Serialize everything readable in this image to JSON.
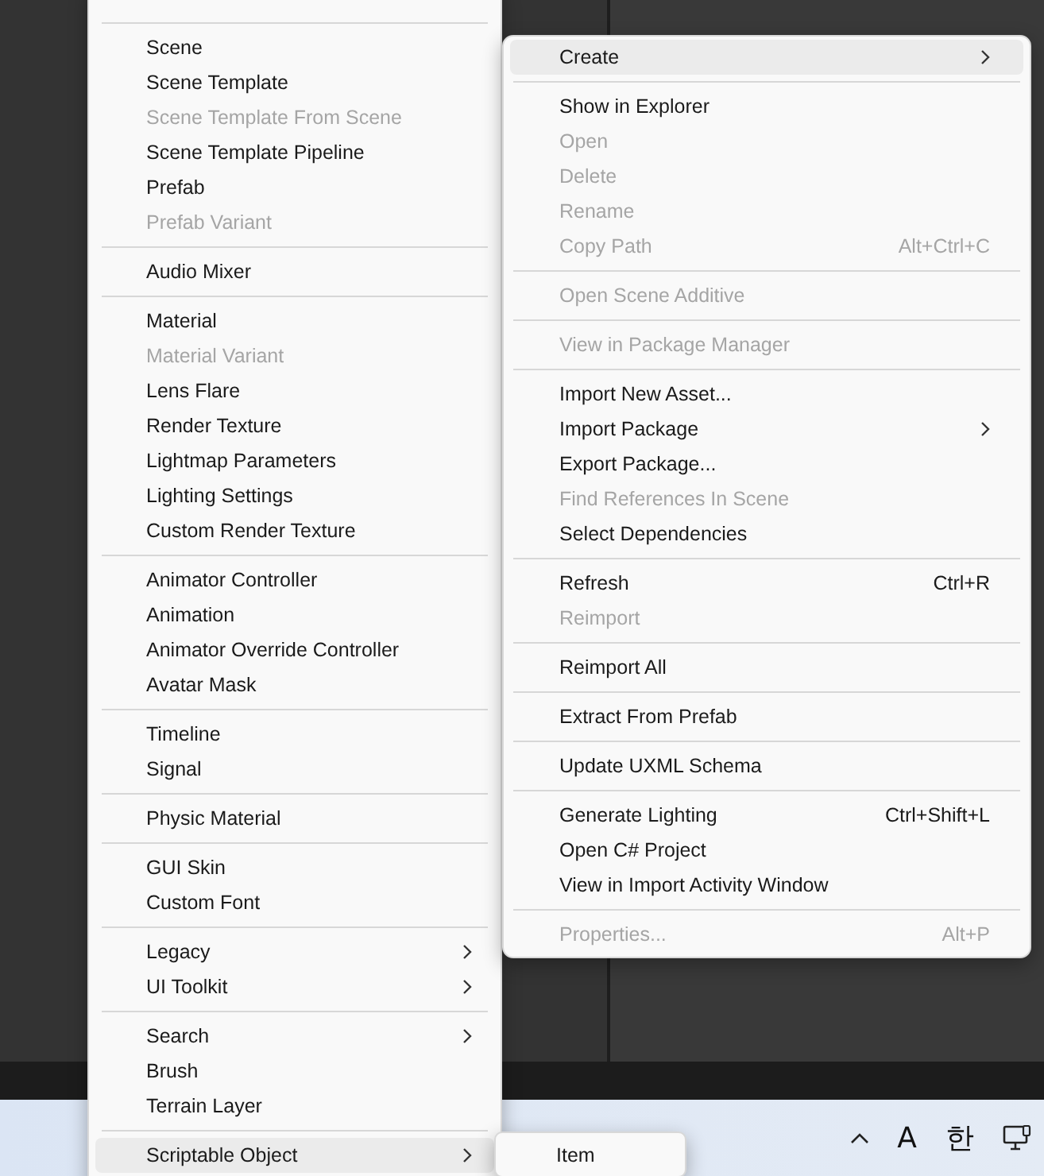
{
  "left_menu": {
    "items": [
      {
        "kind": "separator"
      },
      {
        "kind": "item",
        "label": "Scene",
        "disabled": false,
        "submenu": false,
        "selected": false
      },
      {
        "kind": "item",
        "label": "Scene Template",
        "disabled": false,
        "submenu": false,
        "selected": false
      },
      {
        "kind": "item",
        "label": "Scene Template From Scene",
        "disabled": true,
        "submenu": false,
        "selected": false
      },
      {
        "kind": "item",
        "label": "Scene Template Pipeline",
        "disabled": false,
        "submenu": false,
        "selected": false
      },
      {
        "kind": "item",
        "label": "Prefab",
        "disabled": false,
        "submenu": false,
        "selected": false
      },
      {
        "kind": "item",
        "label": "Prefab Variant",
        "disabled": true,
        "submenu": false,
        "selected": false
      },
      {
        "kind": "separator"
      },
      {
        "kind": "item",
        "label": "Audio Mixer",
        "disabled": false,
        "submenu": false,
        "selected": false
      },
      {
        "kind": "separator"
      },
      {
        "kind": "item",
        "label": "Material",
        "disabled": false,
        "submenu": false,
        "selected": false
      },
      {
        "kind": "item",
        "label": "Material Variant",
        "disabled": true,
        "submenu": false,
        "selected": false
      },
      {
        "kind": "item",
        "label": "Lens Flare",
        "disabled": false,
        "submenu": false,
        "selected": false
      },
      {
        "kind": "item",
        "label": "Render Texture",
        "disabled": false,
        "submenu": false,
        "selected": false
      },
      {
        "kind": "item",
        "label": "Lightmap Parameters",
        "disabled": false,
        "submenu": false,
        "selected": false
      },
      {
        "kind": "item",
        "label": "Lighting Settings",
        "disabled": false,
        "submenu": false,
        "selected": false
      },
      {
        "kind": "item",
        "label": "Custom Render Texture",
        "disabled": false,
        "submenu": false,
        "selected": false
      },
      {
        "kind": "separator"
      },
      {
        "kind": "item",
        "label": "Animator Controller",
        "disabled": false,
        "submenu": false,
        "selected": false
      },
      {
        "kind": "item",
        "label": "Animation",
        "disabled": false,
        "submenu": false,
        "selected": false
      },
      {
        "kind": "item",
        "label": "Animator Override Controller",
        "disabled": false,
        "submenu": false,
        "selected": false
      },
      {
        "kind": "item",
        "label": "Avatar Mask",
        "disabled": false,
        "submenu": false,
        "selected": false
      },
      {
        "kind": "separator"
      },
      {
        "kind": "item",
        "label": "Timeline",
        "disabled": false,
        "submenu": false,
        "selected": false
      },
      {
        "kind": "item",
        "label": "Signal",
        "disabled": false,
        "submenu": false,
        "selected": false
      },
      {
        "kind": "separator"
      },
      {
        "kind": "item",
        "label": "Physic Material",
        "disabled": false,
        "submenu": false,
        "selected": false
      },
      {
        "kind": "separator"
      },
      {
        "kind": "item",
        "label": "GUI Skin",
        "disabled": false,
        "submenu": false,
        "selected": false
      },
      {
        "kind": "item",
        "label": "Custom Font",
        "disabled": false,
        "submenu": false,
        "selected": false
      },
      {
        "kind": "separator"
      },
      {
        "kind": "item",
        "label": "Legacy",
        "disabled": false,
        "submenu": true,
        "selected": false
      },
      {
        "kind": "item",
        "label": "UI Toolkit",
        "disabled": false,
        "submenu": true,
        "selected": false
      },
      {
        "kind": "separator"
      },
      {
        "kind": "item",
        "label": "Search",
        "disabled": false,
        "submenu": true,
        "selected": false
      },
      {
        "kind": "item",
        "label": "Brush",
        "disabled": false,
        "submenu": false,
        "selected": false
      },
      {
        "kind": "item",
        "label": "Terrain Layer",
        "disabled": false,
        "submenu": false,
        "selected": false
      },
      {
        "kind": "separator"
      },
      {
        "kind": "item",
        "label": "Scriptable Object",
        "disabled": false,
        "submenu": true,
        "selected": true
      }
    ]
  },
  "context_menu": {
    "items": [
      {
        "kind": "item",
        "label": "Create",
        "disabled": false,
        "submenu": true,
        "selected": true
      },
      {
        "kind": "separator"
      },
      {
        "kind": "item",
        "label": "Show in Explorer",
        "disabled": false,
        "submenu": false,
        "selected": false
      },
      {
        "kind": "item",
        "label": "Open",
        "disabled": true,
        "submenu": false,
        "selected": false
      },
      {
        "kind": "item",
        "label": "Delete",
        "disabled": true,
        "submenu": false,
        "selected": false
      },
      {
        "kind": "item",
        "label": "Rename",
        "disabled": true,
        "submenu": false,
        "selected": false
      },
      {
        "kind": "item",
        "label": "Copy Path",
        "disabled": true,
        "submenu": false,
        "selected": false,
        "shortcut": "Alt+Ctrl+C"
      },
      {
        "kind": "separator"
      },
      {
        "kind": "item",
        "label": "Open Scene Additive",
        "disabled": true,
        "submenu": false,
        "selected": false
      },
      {
        "kind": "separator"
      },
      {
        "kind": "item",
        "label": "View in Package Manager",
        "disabled": true,
        "submenu": false,
        "selected": false
      },
      {
        "kind": "separator"
      },
      {
        "kind": "item",
        "label": "Import New Asset...",
        "disabled": false,
        "submenu": false,
        "selected": false
      },
      {
        "kind": "item",
        "label": "Import Package",
        "disabled": false,
        "submenu": true,
        "selected": false
      },
      {
        "kind": "item",
        "label": "Export Package...",
        "disabled": false,
        "submenu": false,
        "selected": false
      },
      {
        "kind": "item",
        "label": "Find References In Scene",
        "disabled": true,
        "submenu": false,
        "selected": false
      },
      {
        "kind": "item",
        "label": "Select Dependencies",
        "disabled": false,
        "submenu": false,
        "selected": false
      },
      {
        "kind": "separator"
      },
      {
        "kind": "item",
        "label": "Refresh",
        "disabled": false,
        "submenu": false,
        "selected": false,
        "shortcut": "Ctrl+R"
      },
      {
        "kind": "item",
        "label": "Reimport",
        "disabled": true,
        "submenu": false,
        "selected": false
      },
      {
        "kind": "separator"
      },
      {
        "kind": "item",
        "label": "Reimport All",
        "disabled": false,
        "submenu": false,
        "selected": false
      },
      {
        "kind": "separator"
      },
      {
        "kind": "item",
        "label": "Extract From Prefab",
        "disabled": false,
        "submenu": false,
        "selected": false
      },
      {
        "kind": "separator"
      },
      {
        "kind": "item",
        "label": "Update UXML Schema",
        "disabled": false,
        "submenu": false,
        "selected": false
      },
      {
        "kind": "separator"
      },
      {
        "kind": "item",
        "label": "Generate Lighting",
        "disabled": false,
        "submenu": false,
        "selected": false,
        "shortcut": "Ctrl+Shift+L"
      },
      {
        "kind": "item",
        "label": "Open C# Project",
        "disabled": false,
        "submenu": false,
        "selected": false
      },
      {
        "kind": "item",
        "label": "View in Import Activity Window",
        "disabled": false,
        "submenu": false,
        "selected": false
      },
      {
        "kind": "separator"
      },
      {
        "kind": "item",
        "label": "Properties...",
        "disabled": true,
        "submenu": false,
        "selected": false,
        "shortcut": "Alt+P"
      }
    ]
  },
  "sub_menu": {
    "items": [
      {
        "kind": "item",
        "label": "Item",
        "disabled": false,
        "submenu": false,
        "selected": false
      }
    ]
  },
  "taskbar": {
    "tray": [
      {
        "kind": "caret"
      },
      {
        "kind": "text",
        "label": "A"
      },
      {
        "kind": "text",
        "label": "한"
      },
      {
        "kind": "network"
      }
    ]
  }
}
